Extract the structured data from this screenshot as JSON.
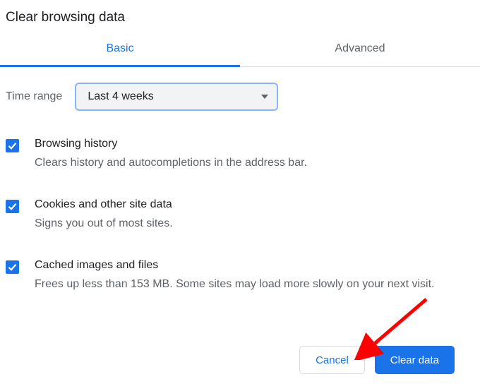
{
  "dialog": {
    "title": "Clear browsing data"
  },
  "tabs": {
    "basic": "Basic",
    "advanced": "Advanced"
  },
  "time_range": {
    "label": "Time range",
    "value": "Last 4 weeks"
  },
  "options": [
    {
      "title": "Browsing history",
      "description": "Clears history and autocompletions in the address bar.",
      "checked": true
    },
    {
      "title": "Cookies and other site data",
      "description": "Signs you out of most sites.",
      "checked": true
    },
    {
      "title": "Cached images and files",
      "description": "Frees up less than 153 MB. Some sites may load more slowly on your next visit.",
      "checked": true
    }
  ],
  "buttons": {
    "cancel": "Cancel",
    "clear": "Clear data"
  }
}
